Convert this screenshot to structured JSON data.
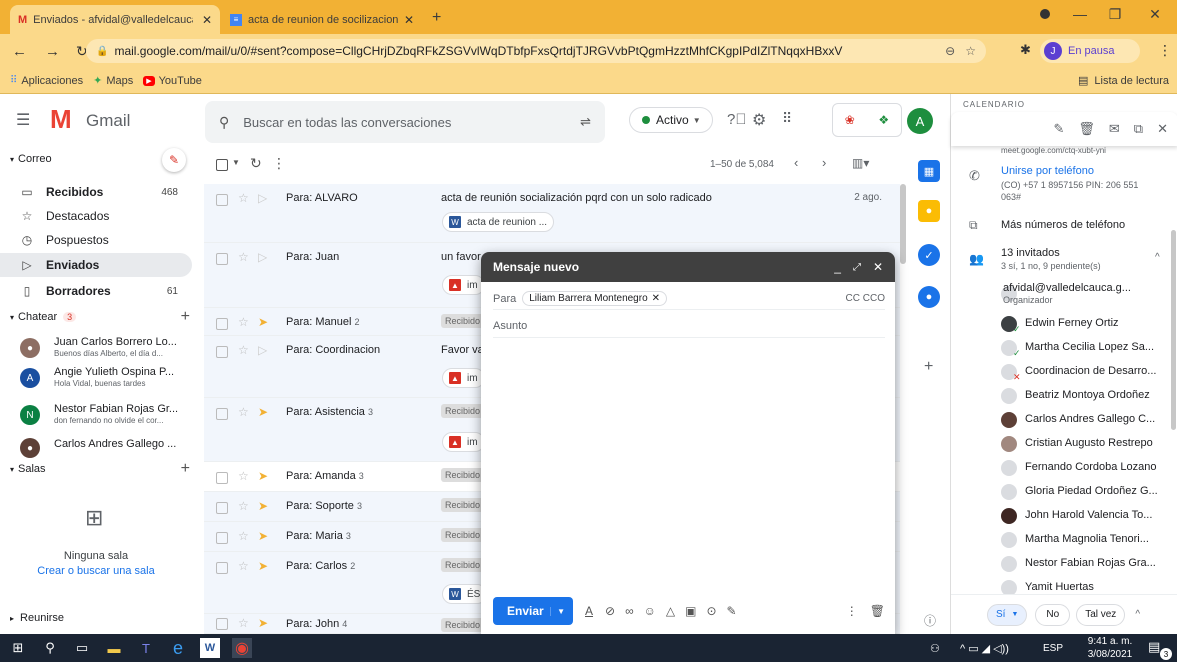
{
  "browser": {
    "tabs": [
      {
        "title": "Enviados - afvidal@valledelcauca",
        "active": true
      },
      {
        "title": "acta de reunion de socilizacion d",
        "active": false
      }
    ],
    "new_tab": "+",
    "url": "mail.google.com/mail/u/0/#sent?compose=CllgCHrjDZbqRFkZSGVvlWqDTbfpFxsQrtdjTJRGVvbPtQgmHzztMhfCKgpIPdIZlTNqqxHBxxV",
    "profile_initial": "J",
    "profile_status": "En pausa",
    "bookmarks": [
      "Aplicaciones",
      "Maps",
      "YouTube"
    ],
    "reading_list": "Lista de lectura"
  },
  "gmail": {
    "app_name": "Gmail",
    "search_placeholder": "Buscar en todas las conversaciones",
    "status": "Activo",
    "avatar_initial": "A"
  },
  "nav": {
    "mail_section": "Correo",
    "items": [
      {
        "label": "Recibidos",
        "count": "468"
      },
      {
        "label": "Destacados",
        "count": ""
      },
      {
        "label": "Pospuestos",
        "count": ""
      },
      {
        "label": "Enviados",
        "count": ""
      },
      {
        "label": "Borradores",
        "count": "61"
      }
    ],
    "chat_section": "Chatear",
    "chat_count": "3",
    "chats": [
      {
        "name": "Juan Carlos Borrero Lo...",
        "preview": "Buenos días Alberto, el día d..."
      },
      {
        "name": "Angie Yulieth Ospina P...",
        "preview": "Hola Vidal, buenas tardes"
      },
      {
        "name": "Nestor Fabian Rojas Gr...",
        "preview": "don fernando no olvide el cor..."
      },
      {
        "name": "Carlos Andres Gallego ...",
        "preview": ""
      }
    ],
    "rooms_section": "Salas",
    "no_rooms": "Ninguna sala",
    "find_room": "Crear o buscar una sala",
    "meet_section": "Reunirse"
  },
  "list": {
    "pagination": "1–50 de 5,084",
    "rows": [
      {
        "to": "Para: ALVARO",
        "subject": "acta de reunión socialización pqrd con un solo radicado",
        "date": "2 ago.",
        "attachment": "acta de reunion ...",
        "label": ""
      },
      {
        "to": "Para: Juan",
        "subject": "un favor",
        "date": "",
        "attachment": "im",
        "label": ""
      },
      {
        "to": "Para: Manuel",
        "count": "2",
        "subject": "",
        "date": "",
        "attachment": "",
        "label": "Recibido"
      },
      {
        "to": "Para: Coordinacion",
        "subject": "Favor va",
        "date": "",
        "attachment": "im",
        "label": ""
      },
      {
        "to": "Para: Asistencia",
        "count": "3",
        "subject": "",
        "date": "",
        "attachment": "im",
        "label": "Recibido"
      },
      {
        "to": "Para: Amanda",
        "count": "3",
        "subject": "",
        "date": "",
        "attachment": "",
        "label": "Recibido"
      },
      {
        "to": "Para: Soporte",
        "count": "3",
        "subject": "",
        "date": "",
        "attachment": "",
        "label": "Recibido"
      },
      {
        "to": "Para: Maria",
        "count": "3",
        "subject": "",
        "date": "",
        "attachment": "",
        "label": "Recibido"
      },
      {
        "to": "Para: Carlos",
        "count": "2",
        "subject": "",
        "date": "",
        "attachment": "ÉS",
        "label": "Recibido"
      },
      {
        "to": "Para: John",
        "count": "4",
        "subject": "",
        "date": "",
        "attachment": "",
        "label": "Recibido"
      }
    ]
  },
  "compose": {
    "title": "Mensaje nuevo",
    "to_label": "Para",
    "recipient": "Liliam Barrera Montenegro",
    "cc_bcc": "CC CCO",
    "subject_placeholder": "Asunto",
    "send": "Enviar"
  },
  "calendar": {
    "title": "CALENDARIO",
    "meet_link": "meet.google.com/ctq-xubt-yni",
    "phone_title": "Unirse por teléfono",
    "phone_detail": "(CO) +57 1 8957156 PIN: 206 551",
    "phone_detail2": "063#",
    "more_numbers": "Más números de teléfono",
    "guests_count": "13 invitados",
    "guests_summary": "3 sí, 1 no, 9 pendiente(s)",
    "organizer_role": "Organizador",
    "guests": [
      "afvidal@valledelcauca.g...",
      "Edwin Ferney Ortiz",
      "Martha Cecilia Lopez Sa...",
      "Coordinacion de Desarro...",
      "Beatriz Montoya Ordoñez",
      "Carlos Andres Gallego C...",
      "Cristian Augusto Restrepo",
      "Fernando Cordoba Lozano",
      "Gloria Piedad Ordoñez G...",
      "John Harold Valencia To...",
      "Martha Magnolia Tenori...",
      "Nestor Fabian Rojas Gra...",
      "Yamit Huertas"
    ],
    "rsvp": [
      "Sí",
      "No",
      "Tal vez"
    ]
  },
  "taskbar": {
    "lang": "ESP",
    "time": "9:41 a. m.",
    "date": "3/08/2021",
    "notif": "3"
  },
  "colors": {
    "chrome_bar": "#f2b134",
    "compose_head": "#404040",
    "send_button": "#1a73e8",
    "link": "#1a73e8"
  }
}
